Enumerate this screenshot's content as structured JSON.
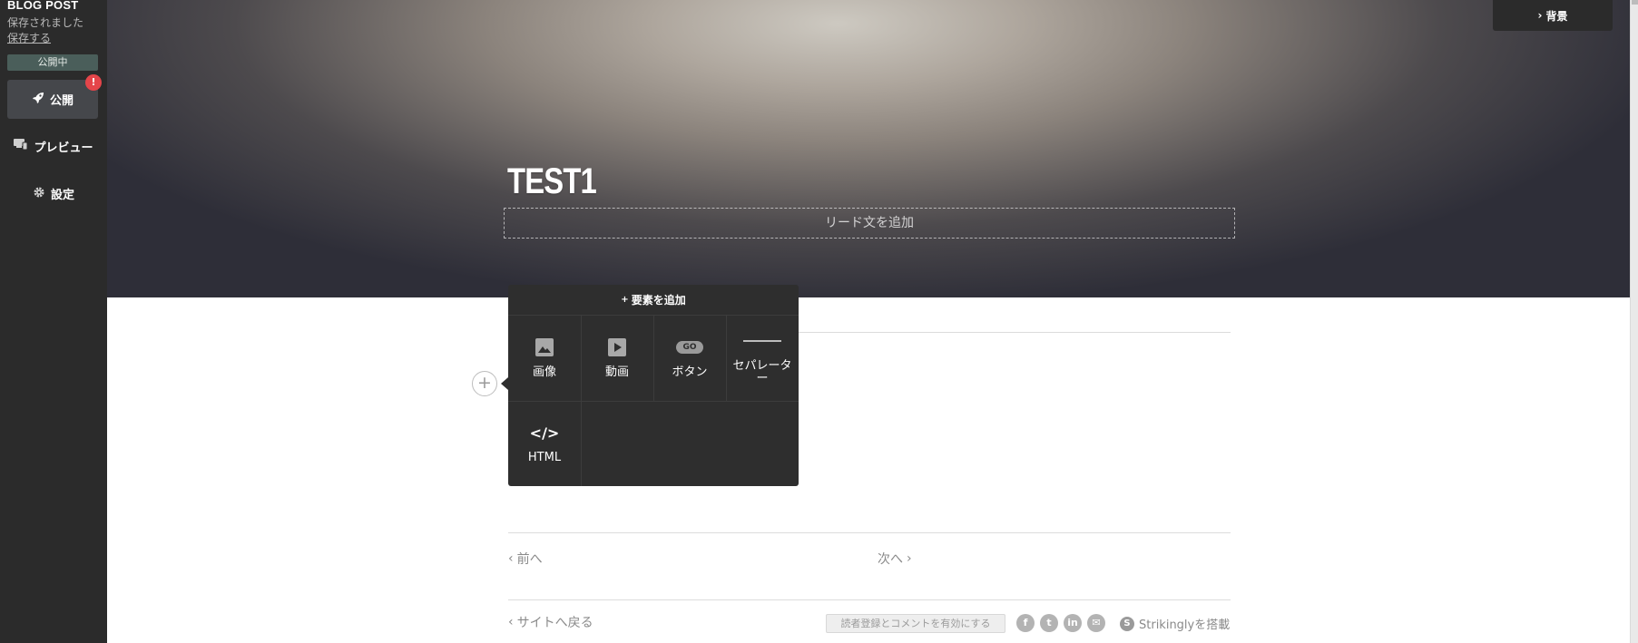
{
  "sidebar": {
    "title": "BLOG POST",
    "saved_text": "保存されました",
    "save_link": "保存する",
    "status_badge": "公開中",
    "publish_label": "公開",
    "publish_icon": "rocket-icon",
    "alert_badge": "!",
    "preview_label": "プレビュー",
    "preview_icon": "devices-icon",
    "settings_label": "設定",
    "settings_icon": "gear-icon"
  },
  "hero": {
    "title": "TEST1",
    "lead_placeholder": "リード文を追加",
    "background_button": "背景"
  },
  "popup": {
    "title": "要素を追加",
    "items": [
      {
        "label": "画像",
        "icon": "image-icon"
      },
      {
        "label": "動画",
        "icon": "video-icon"
      },
      {
        "label": "ボタン",
        "icon": "button-icon",
        "badge": "GO"
      },
      {
        "label": "セパレーター",
        "icon": "separator-icon"
      },
      {
        "label": "HTML",
        "icon": "html-icon",
        "glyph": "</>"
      }
    ]
  },
  "add_button": "+",
  "footer": {
    "prev": "前へ",
    "next": "次へ",
    "back": "サイトへ戻る",
    "comments_button": "読者登録とコメントを有効にする",
    "social": [
      {
        "name": "facebook-icon",
        "glyph": "f"
      },
      {
        "name": "twitter-icon",
        "glyph": "t"
      },
      {
        "name": "linkedin-icon",
        "glyph": "in"
      },
      {
        "name": "email-icon",
        "glyph": "✉"
      }
    ],
    "powered_by": "Strikinglyを搭載",
    "strikingly_logo": "S"
  },
  "colors": {
    "sidebar_bg": "#2b2b2b",
    "popup_bg": "#2e2e2e",
    "alert_red": "#e5454a",
    "status_green": "#4a5e5a"
  }
}
